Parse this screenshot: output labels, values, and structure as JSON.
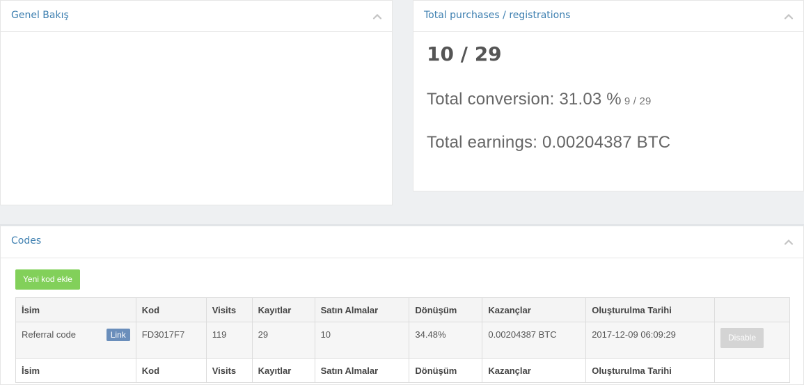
{
  "overview_panel": {
    "title": "Genel Bakış"
  },
  "total_panel": {
    "title": "Total purchases / registrations",
    "ratio": "10 / 29",
    "conversion_label": "Total conversion: 31.03 %",
    "conversion_detail": "9 / 29",
    "earnings_label": "Total earnings: 0.00204387 BTC"
  },
  "codes_panel": {
    "title": "Codes",
    "add_button": "Yeni kod ekle",
    "columns": [
      "İsim",
      "Kod",
      "Visits",
      "Kayıtlar",
      "Satın Almalar",
      "Dönüşüm",
      "Kazançlar",
      "Oluşturulma Tarihi",
      ""
    ],
    "rows": [
      {
        "name": "Referral code",
        "link_label": "Link",
        "code": "FD3017F7",
        "visits": "119",
        "registrations": "29",
        "purchases": "10",
        "conversion": "34.48%",
        "earnings": "0.00204387 BTC",
        "created": "2017-12-09 06:09:29",
        "action": "Disable"
      }
    ]
  },
  "colors": {
    "title_blue": "#3d7fb0",
    "add_green": "#82d05a",
    "link_blue": "#6a8ebb",
    "disabled_gray": "#d4d4d4"
  },
  "icons": {
    "collapse": "chevron-up-icon"
  }
}
